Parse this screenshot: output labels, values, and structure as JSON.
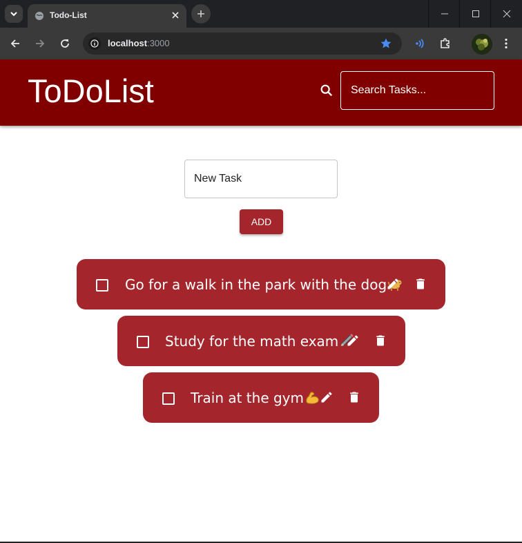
{
  "browser": {
    "tab_title": "Todo-List",
    "url_host": "localhost",
    "url_port": ":3000"
  },
  "app": {
    "title": "ToDoList",
    "search_placeholder": "Search Tasks...",
    "new_task_placeholder": "New Task",
    "add_label": "ADD",
    "colors": {
      "header": "#800000",
      "card": "#a4262c",
      "button": "#a4262c"
    }
  },
  "todos": [
    {
      "text": "Go for a walk in the park with the dog",
      "emoji_icon": "dog-icon",
      "done": false
    },
    {
      "text": "Study for the math exam",
      "emoji_icon": "pencil-icon",
      "done": false
    },
    {
      "text": "Train at the gym",
      "emoji_icon": "flexed-biceps-icon",
      "done": false
    }
  ]
}
